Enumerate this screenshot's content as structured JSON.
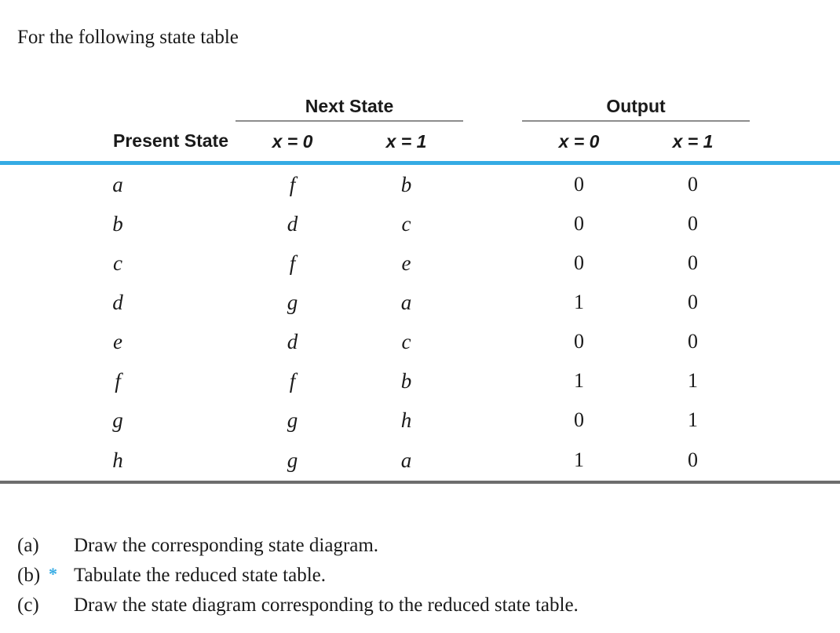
{
  "intro": {
    "text": "For the following state table"
  },
  "table": {
    "group_headers": {
      "present_blank": "",
      "next_state": "Next State",
      "output": "Output"
    },
    "sub_headers": {
      "present_state": "Present State",
      "next_x0": "x = 0",
      "next_x1": "x = 1",
      "out_x0": "x = 0",
      "out_x1": "x = 1"
    },
    "rows": [
      {
        "present": "a",
        "next_x0": "f",
        "next_x1": "b",
        "out_x0": "0",
        "out_x1": "0"
      },
      {
        "present": "b",
        "next_x0": "d",
        "next_x1": "c",
        "out_x0": "0",
        "out_x1": "0"
      },
      {
        "present": "c",
        "next_x0": "f",
        "next_x1": "e",
        "out_x0": "0",
        "out_x1": "0"
      },
      {
        "present": "d",
        "next_x0": "g",
        "next_x1": "a",
        "out_x0": "1",
        "out_x1": "0"
      },
      {
        "present": "e",
        "next_x0": "d",
        "next_x1": "c",
        "out_x0": "0",
        "out_x1": "0"
      },
      {
        "present": "f",
        "next_x0": "f",
        "next_x1": "b",
        "out_x0": "1",
        "out_x1": "1"
      },
      {
        "present": "g",
        "next_x0": "g",
        "next_x1": "h",
        "out_x0": "0",
        "out_x1": "1"
      },
      {
        "present": "h",
        "next_x0": "g",
        "next_x1": "a",
        "out_x0": "1",
        "out_x1": "0"
      }
    ]
  },
  "questions": [
    {
      "label": "(a)",
      "star": "",
      "text": "Draw the corresponding state diagram."
    },
    {
      "label": "(b)",
      "star": "*",
      "text": "Tabulate the reduced state table."
    },
    {
      "label": "(c)",
      "star": "",
      "text": "Draw the state diagram corresponding to the reduced state table."
    }
  ],
  "colors": {
    "accent_blue": "#35ABE4",
    "rule_gray": "#8d8d8d",
    "bottom_rule_gray": "#6d6d6d",
    "text": "#1a1a1a"
  }
}
